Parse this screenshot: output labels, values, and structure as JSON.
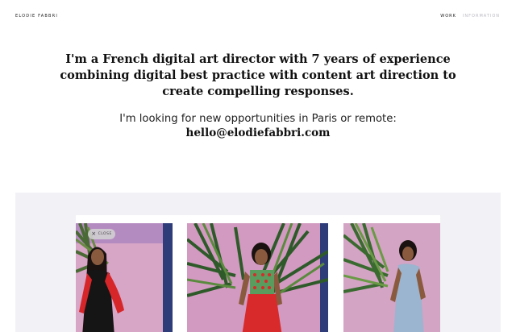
{
  "header": {
    "logo": "ELODIE FABBRI",
    "nav": [
      {
        "label": "WORK",
        "active": true
      },
      {
        "label": "INFORMATION",
        "active": false
      }
    ]
  },
  "intro": {
    "lines": [
      "I'm a French digital art director with 7 years of experience",
      "combining digital best practice with content art direction to",
      "create compelling responses."
    ],
    "looking_for": "I'm looking for new opportunities in Paris or remote:",
    "email": "hello@elodiefabbri.com"
  },
  "gallery": {
    "close_label": "CLOSE",
    "background": "#f2f2f6",
    "photos": [
      {
        "name": "woman in red top and black skirt against pink wall",
        "dress": "#d6262a",
        "skirt": "#151515"
      },
      {
        "name": "woman in green patterned top and red skirt among palms",
        "dress": "#5a9b5e",
        "skirt": "#d82a2a"
      },
      {
        "name": "woman in light blue knit dress against pink wall",
        "dress": "#9bb4cf",
        "skirt": "#9bb4cf"
      }
    ]
  }
}
